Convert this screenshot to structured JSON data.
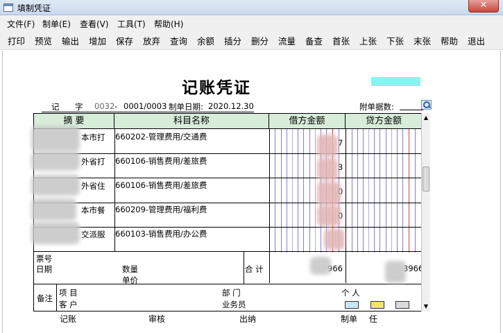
{
  "window": {
    "title": "填制凭证",
    "close_glyph": "✕"
  },
  "menu": [
    "文件(F)",
    "制单(E)",
    "查看(V)",
    "工具(T)",
    "帮助(H)"
  ],
  "toolbar": [
    "打印",
    "预览",
    "输出",
    "增加",
    "保存",
    "放弃",
    "查询",
    "余额",
    "插分",
    "删分",
    "流量",
    "备查",
    "首张",
    "上张",
    "下张",
    "末张",
    "帮助",
    "退出"
  ],
  "voucher": {
    "title": "记账凭证",
    "word_label": "记",
    "zi_label": "字",
    "number": "0032",
    "dash": "-",
    "sequence": "0001/0003",
    "date_label": "制单日期:",
    "date": "2020.12.30",
    "attachments_label": "附单据数:",
    "headers": {
      "summary": "摘 要",
      "account": "科目名称",
      "debit": "借方金额",
      "credit": "贷方金额"
    },
    "rows": [
      {
        "summary_visible": "本市打",
        "account": "660202-管理费用/交通费",
        "debit_visible": "7"
      },
      {
        "summary_visible": "外省打",
        "account": "660106-销售费用/差旅费",
        "debit_visible": "3"
      },
      {
        "summary_visible": "外省住",
        "account": "660106-销售费用/差旅费",
        "debit_visible": "0"
      },
      {
        "summary_visible": "本市餐",
        "account": "660209-管理费用/福利费",
        "debit_visible": "0"
      },
      {
        "summary_visible": "交派服",
        "account": "660103-销售费用/办公费",
        "debit_visible": ""
      }
    ],
    "bill_no_label": "票号",
    "date_field_label": "日期",
    "quantity_label": "数量",
    "unit_price_label": "单价",
    "total_label": "合 计",
    "debit_total_visible": "966",
    "credit_total_visible": "3966",
    "notes_label": "备注",
    "project_label": "项   目",
    "department_label": "部   门",
    "person_label": "个   人",
    "customer_label": "客   户",
    "salesman_label": "业务员",
    "footer": {
      "bookkeeper": "记账",
      "auditor": "审核",
      "cashier": "出纳",
      "preparer": "制单",
      "preparer_suffix": "任"
    }
  }
}
